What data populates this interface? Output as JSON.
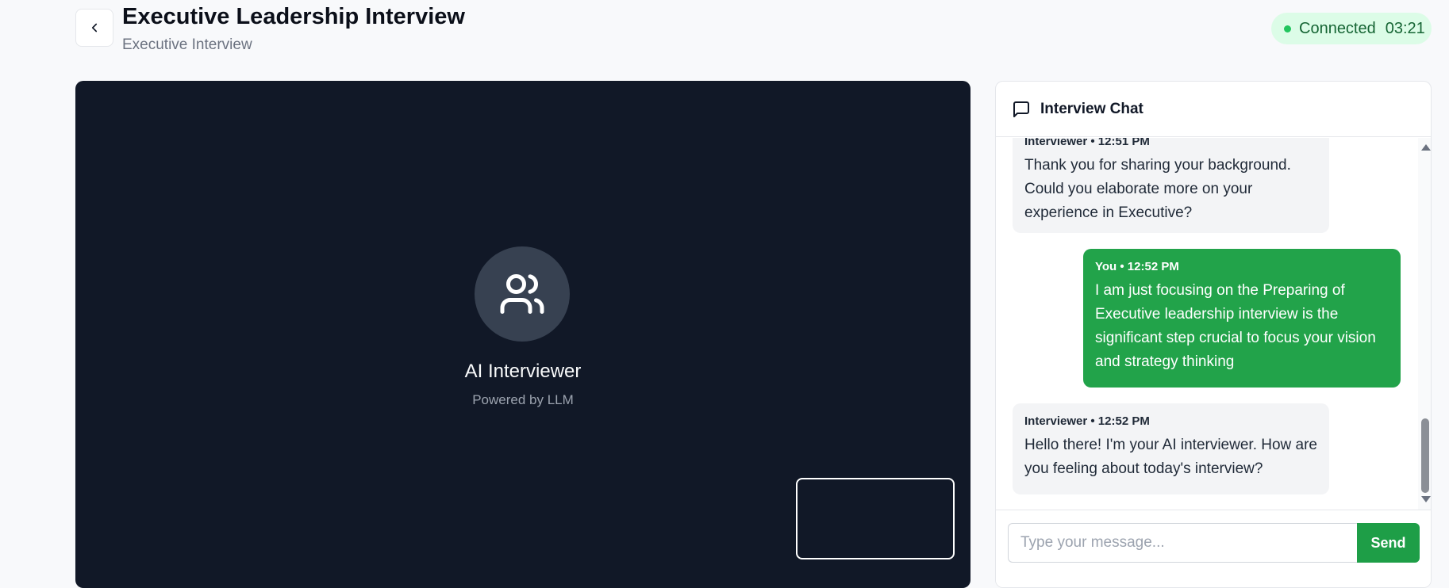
{
  "header": {
    "back_icon": "chevron-left-icon",
    "title": "Executive Leadership Interview",
    "subtitle": "Executive Interview"
  },
  "status": {
    "label": "Connected",
    "timer": "03:21",
    "color": "#22c55e"
  },
  "video": {
    "avatar_icon": "users-icon",
    "name": "AI Interviewer",
    "powered_by": "Powered by LLM"
  },
  "chat": {
    "icon": "message-square-icon",
    "title": "Interview Chat",
    "messages": [
      {
        "sender": "Interviewer",
        "meta": "Interviewer • 12:51 PM",
        "text": "Thank you for sharing your background. Could you elaborate more on your experience in Executive?"
      },
      {
        "sender": "You",
        "meta": "You • 12:52 PM",
        "text": "I am just focusing on the Preparing of Executive leadership interview is the significant step crucial to focus your vision and strategy thinking"
      },
      {
        "sender": "Interviewer",
        "meta": "Interviewer • 12:52 PM",
        "text": "Hello there! I'm your AI interviewer. How are you feeling about today's interview?"
      }
    ],
    "input_placeholder": "Type your message...",
    "input_value": "",
    "send_label": "Send"
  },
  "colors": {
    "accent": "#22a34a",
    "video_bg": "#111827"
  }
}
